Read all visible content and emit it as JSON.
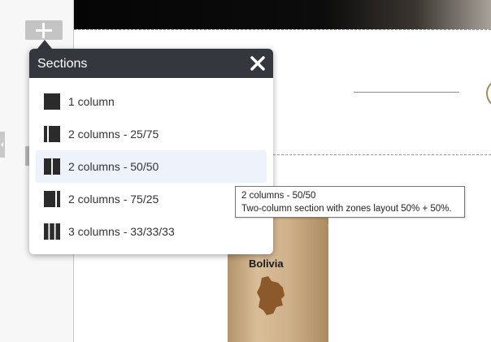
{
  "popup": {
    "title": "Sections",
    "items": [
      {
        "label": "1 column",
        "icon": "one-column-layout-icon",
        "selected": false
      },
      {
        "label": "2 columns - 25/75",
        "icon": "two-columns-25-75-icon",
        "selected": false
      },
      {
        "label": "2 columns - 50/50",
        "icon": "two-columns-50-50-icon",
        "selected": true
      },
      {
        "label": "2 columns - 75/25",
        "icon": "two-columns-75-25-icon",
        "selected": false
      },
      {
        "label": "3 columns - 33/33/33",
        "icon": "three-columns-icon",
        "selected": false
      }
    ]
  },
  "tooltip": {
    "title": "2 columns - 50/50",
    "description": "Two-column section with zones layout 50% + 50%."
  },
  "product": {
    "label": "Bolivia"
  },
  "colors": {
    "popup_header": "#34373e",
    "selected_row": "#edf2fb",
    "accent_gold": "#a48b58",
    "add_button": "#c4c4c4"
  }
}
